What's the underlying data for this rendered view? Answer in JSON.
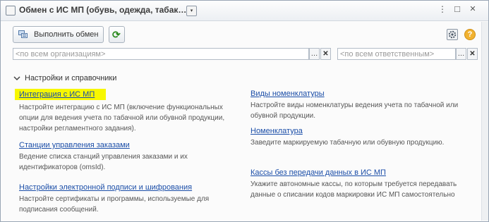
{
  "window": {
    "title": "Обмен с ИС МП (обувь, одежда, табак…)",
    "title_dropdown": "▾",
    "menu_glyph": "⋮",
    "maximize_glyph": "□",
    "close_glyph": "✕"
  },
  "toolbar": {
    "exec_label": "Выполнить обмен",
    "refresh_glyph": "⟳",
    "help_glyph": "?"
  },
  "filters": {
    "org": {
      "placeholder": "<по всем организациям>",
      "value": "",
      "choose_glyph": "…",
      "clear_glyph": "✕"
    },
    "resp": {
      "placeholder": "<по всем ответственным>",
      "value": "",
      "choose_glyph": "…",
      "clear_glyph": "✕"
    }
  },
  "section": {
    "title": "Настройки и справочники"
  },
  "left_items": [
    {
      "label": "Интеграция с ИС МП",
      "description": "Настройте интеграцию с ИС МП (включение функциональных опции для ведения учета по табачной или обувной продукции, настройки регламентного задания)."
    },
    {
      "label": "Станции управления заказами",
      "description": "Ведение списка станций управления заказами и их идентификаторов (omsId)."
    },
    {
      "label": "Настройки электронной подписи и шифрования",
      "description": "Настройте сертификаты и программы, используемые для подписания сообщений."
    }
  ],
  "right_items": [
    {
      "label": "Виды номенклатуры",
      "description": "Настройте виды номенклатуры ведения учета по табачной или обувной продукции."
    },
    {
      "label": "Номенклатура",
      "description": "Заведите маркируемую табачную или обувную продукцию."
    },
    {
      "label": "Кассы без передачи данных в ИС МП",
      "description": "Укажите автономные кассы, по которым требуется передавать данные о списании кодов маркировки ИС МП самостоятельно"
    }
  ],
  "colors": {
    "link": "#1b4ea8",
    "highlight": "#f7f700",
    "accent": "#f1b230"
  }
}
